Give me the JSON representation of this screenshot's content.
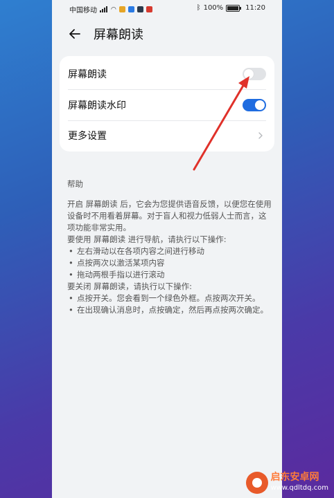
{
  "status": {
    "carrier": "中国移动",
    "battery": "100%",
    "time": "11:20",
    "app_icons": [
      {
        "name": "game-app-icon",
        "color": "#e6a526"
      },
      {
        "name": "blue-app-icon",
        "color": "#2a7be4"
      },
      {
        "name": "dark-app-icon",
        "color": "#2b3a4c"
      },
      {
        "name": "red-app-icon",
        "color": "#d63a2f"
      }
    ]
  },
  "header": {
    "title": "屏幕朗读"
  },
  "settings": {
    "rows": [
      {
        "label": "屏幕朗读",
        "type": "toggle",
        "state": "off"
      },
      {
        "label": "屏幕朗读水印",
        "type": "toggle",
        "state": "on"
      },
      {
        "label": "更多设置",
        "type": "chevron"
      }
    ]
  },
  "help": {
    "title": "帮助",
    "intro": "开启 屏幕朗读 后，它会为您提供语音反馈，以便您在使用设备时不用看着屏幕。对于盲人和视力低弱人士而言，这项功能非常实用。",
    "nav_heading": "要使用 屏幕朗读 进行导航，请执行以下操作:",
    "nav_items": [
      "左右滑动以在各项内容之间进行移动",
      "点按两次以激活某项内容",
      "拖动两根手指以进行滚动"
    ],
    "off_heading": "要关闭 屏幕朗读，请执行以下操作:",
    "off_items": [
      "点按开关。您会看到一个绿色外框。点按两次开关。",
      "在出现确认消息时，点按确定，然后再点按两次确定。"
    ]
  },
  "watermark": {
    "name": "启东安卓网",
    "url": "www.qdltdq.com"
  },
  "colors": {
    "accent": "#1f6ce0",
    "annotation": "#e0312a"
  }
}
